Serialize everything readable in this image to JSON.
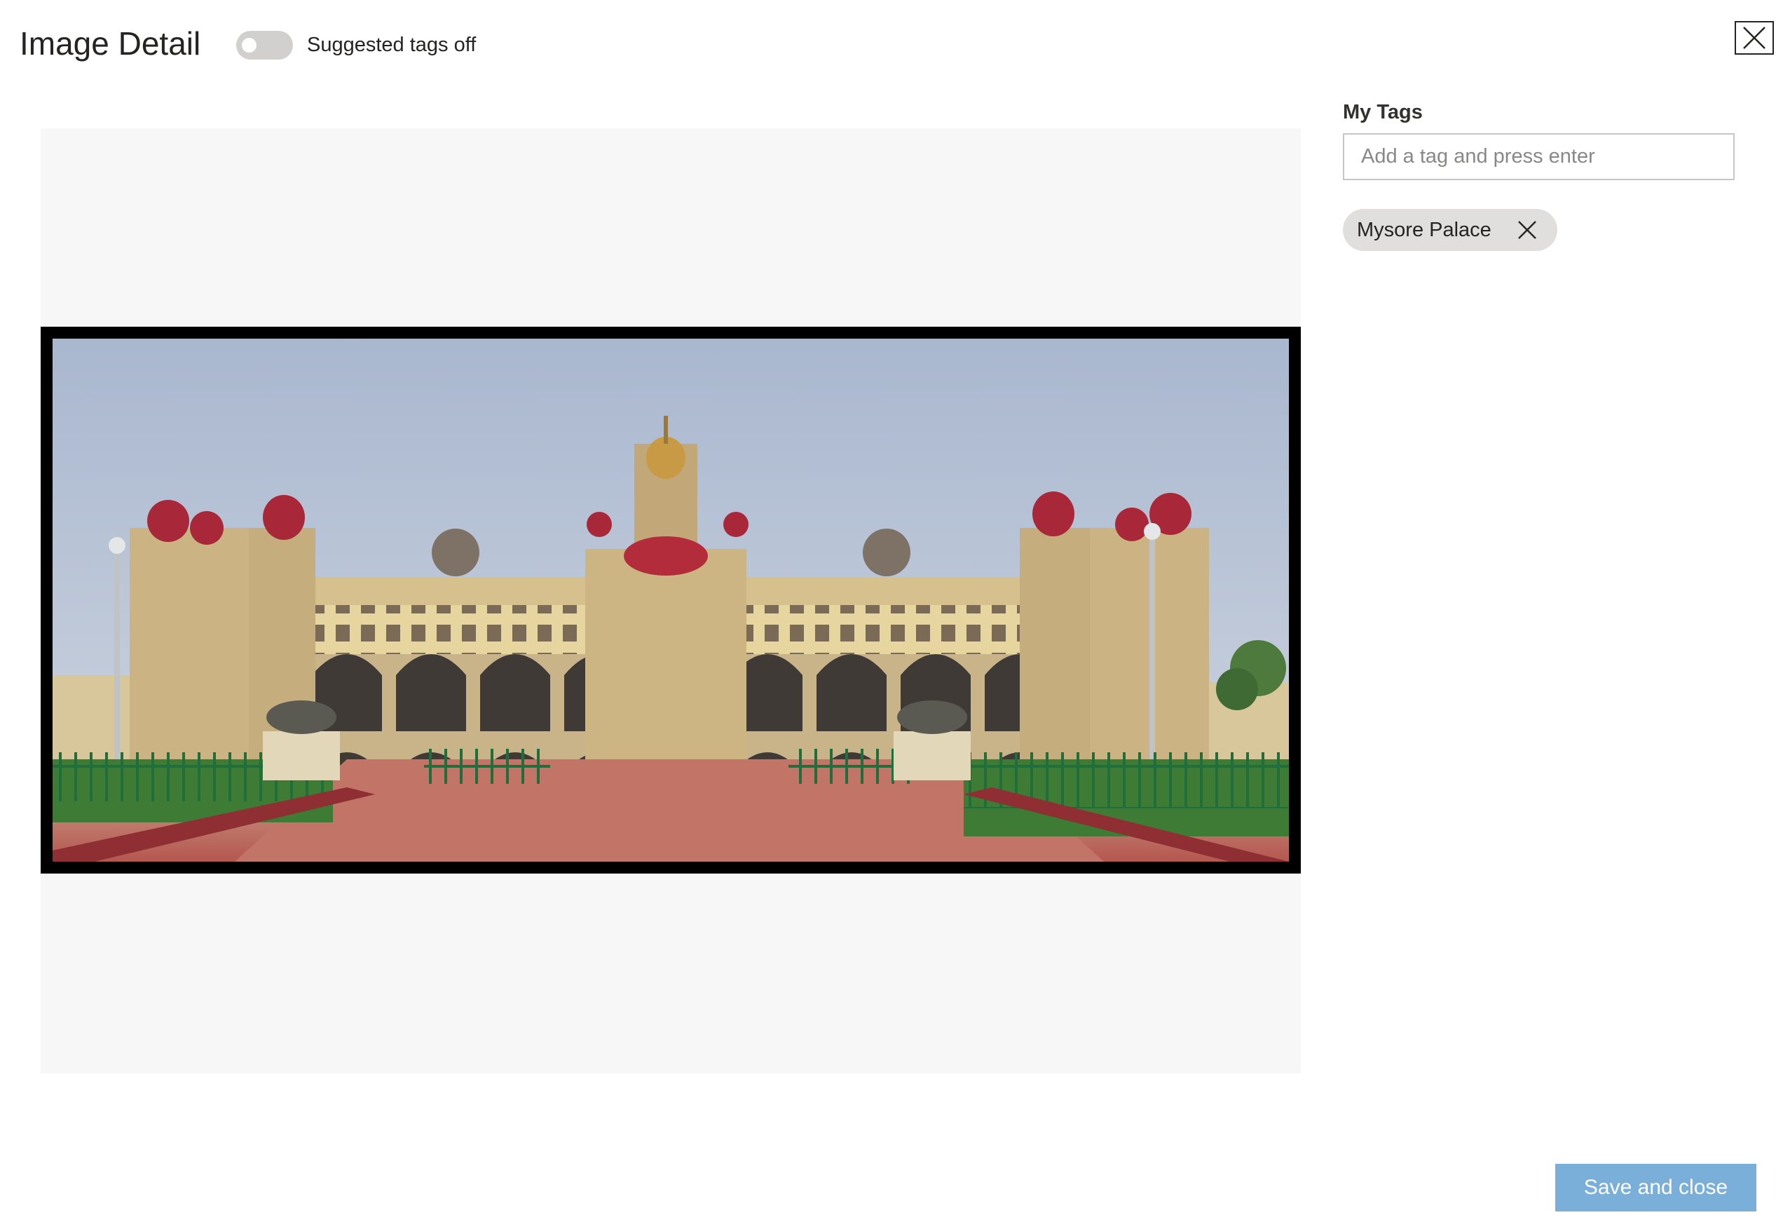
{
  "header": {
    "title": "Image Detail",
    "suggested_tags_toggle": {
      "label": "Suggested tags off",
      "state": "off"
    },
    "close_icon": "close-icon"
  },
  "image": {
    "icon": "photo-mysore-palace"
  },
  "tags_panel": {
    "heading": "My Tags",
    "input_placeholder": "Add a tag and press enter",
    "input_value": "",
    "tags": [
      {
        "label": "Mysore Palace",
        "remove_icon": "close-icon"
      }
    ]
  },
  "footer": {
    "save_label": "Save and close"
  },
  "colors": {
    "toggle_off": "#d2d0ce",
    "tag_chip_bg": "#e1dfdd",
    "primary_disabled": "#7aafd9",
    "image_bg": "#f7f7f7"
  }
}
